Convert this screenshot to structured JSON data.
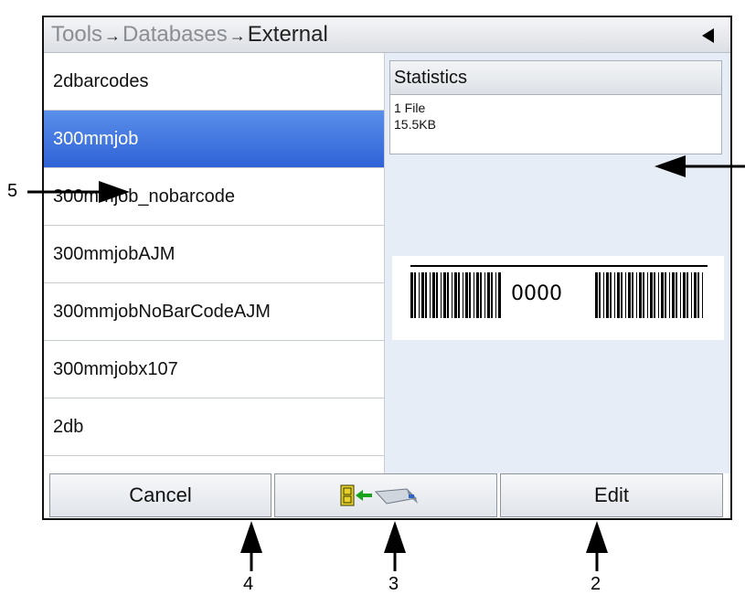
{
  "breadcrumb": {
    "items": [
      "Tools",
      "Databases",
      "External"
    ],
    "separator": "→"
  },
  "databases": {
    "items": [
      {
        "label": "2dbarcodes",
        "selected": false
      },
      {
        "label": "300mmjob",
        "selected": true
      },
      {
        "label": "300mmjob_nobarcode",
        "selected": false
      },
      {
        "label": "300mmjobAJM",
        "selected": false
      },
      {
        "label": "300mmjobNoBarCodeAJM",
        "selected": false
      },
      {
        "label": "300mmjobx107",
        "selected": false
      },
      {
        "label": "2db",
        "selected": false
      }
    ]
  },
  "statistics": {
    "title": "Statistics",
    "files": "1 File",
    "size": "15.5KB"
  },
  "preview": {
    "barcode_text": "0000"
  },
  "buttons": {
    "cancel": "Cancel",
    "edit": "Edit"
  },
  "callouts": {
    "c5": "5",
    "c4": "4",
    "c3": "3",
    "c2": "2"
  },
  "colors": {
    "selection": "#3a6fdf",
    "pane_background": "#e7edf6"
  }
}
